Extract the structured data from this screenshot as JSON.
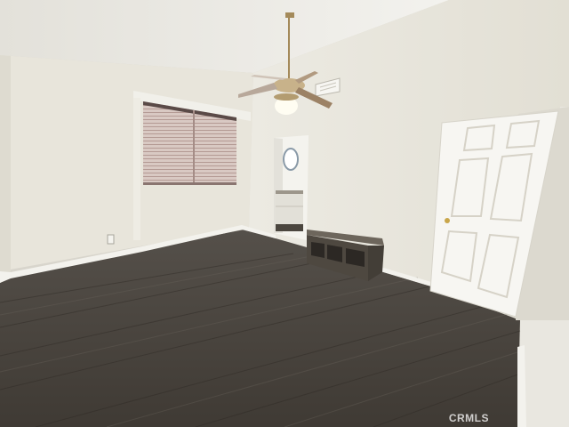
{
  "photo": {
    "subject": "empty-bedroom",
    "watermark": "CRMLS"
  },
  "colors": {
    "ceiling": "#eeece6",
    "left_wall": "#e9e6dc",
    "back_wall": "#e4e1d6",
    "right_wall": "#e7e4da",
    "floor": "#4a443d",
    "door": "#f7f6f2",
    "bench": "#5b554c",
    "baseboard": "#f2f1ec"
  }
}
